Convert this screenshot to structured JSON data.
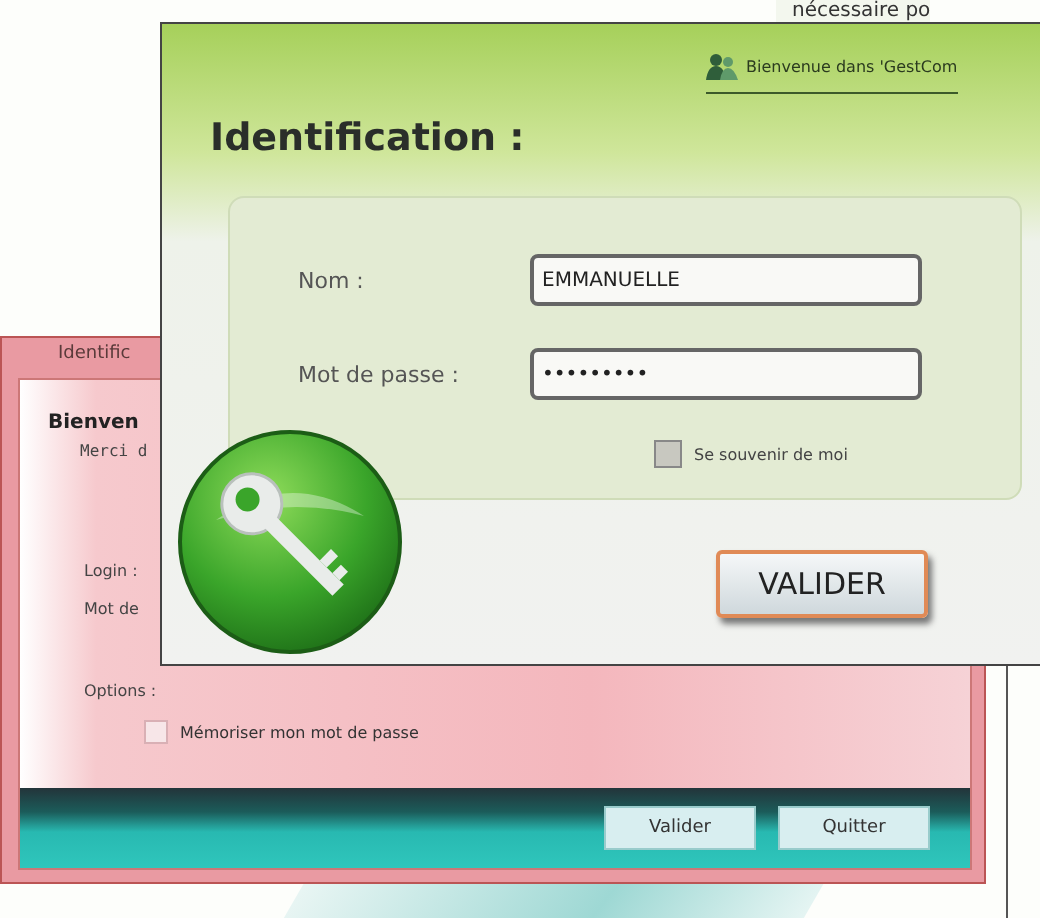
{
  "page_text": "nécessaire po",
  "back_window": {
    "tab": "Identific",
    "heading": "Bienven",
    "subtitle": "Merci d",
    "login_label": "Login :",
    "password_label": "Mot de",
    "options_label": "Options :",
    "remember": {
      "label": "Mémoriser mon mot de passe",
      "checked": false
    },
    "buttons": [
      "Valider",
      "Quitter"
    ]
  },
  "front_window": {
    "banner": "Bienvenue dans 'GestCom",
    "title": "Identification :",
    "fields": [
      {
        "label": "Nom :",
        "value": "EMMANUELLE"
      },
      {
        "label": "Mot de passe :",
        "value": "•••••••••"
      }
    ],
    "remember": {
      "label": "Se souvenir de moi",
      "checked": false
    },
    "button": "VALIDER"
  }
}
